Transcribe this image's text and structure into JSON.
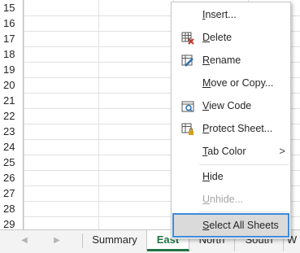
{
  "rows": [
    "15",
    "16",
    "17",
    "18",
    "19",
    "20",
    "21",
    "22",
    "23",
    "24",
    "25",
    "26",
    "27",
    "28",
    "29"
  ],
  "sheet_tabs": {
    "nav_left": "◀",
    "nav_right": "▶",
    "tabs": [
      {
        "label": "Summary",
        "active": false
      },
      {
        "label": "East",
        "active": true
      },
      {
        "label": "North",
        "active": false
      },
      {
        "label": "South",
        "active": false
      },
      {
        "label": "W",
        "active": false
      }
    ]
  },
  "context_menu": {
    "items": [
      {
        "label": "Insert...",
        "underline": "I",
        "icon": "",
        "enabled": true
      },
      {
        "label": "Delete",
        "underline": "D",
        "icon": "delete-sheet-icon",
        "enabled": true
      },
      {
        "label": "Rename",
        "underline": "R",
        "icon": "rename-sheet-icon",
        "enabled": true
      },
      {
        "label": "Move or Copy...",
        "underline": "M",
        "icon": "",
        "enabled": true
      },
      {
        "label": "View Code",
        "underline": "V",
        "icon": "view-code-icon",
        "enabled": true
      },
      {
        "label": "Protect Sheet...",
        "underline": "P",
        "icon": "protect-sheet-icon",
        "enabled": true
      },
      {
        "label": "Tab Color",
        "underline": "T",
        "icon": "",
        "enabled": true,
        "submenu_arrow": ">"
      },
      {
        "label": "Hide",
        "underline": "H",
        "icon": "",
        "enabled": true
      },
      {
        "label": "Unhide...",
        "underline": "U",
        "icon": "",
        "enabled": false
      },
      {
        "label": "Select All Sheets",
        "underline": "S",
        "icon": "",
        "enabled": true,
        "highlighted": true
      }
    ]
  },
  "colors": {
    "accent_green": "#217346",
    "highlight_border": "#3c8bd9",
    "delete_red": "#c0392b",
    "icon_blue": "#2b6cb0",
    "lock_orange": "#d4a017"
  }
}
